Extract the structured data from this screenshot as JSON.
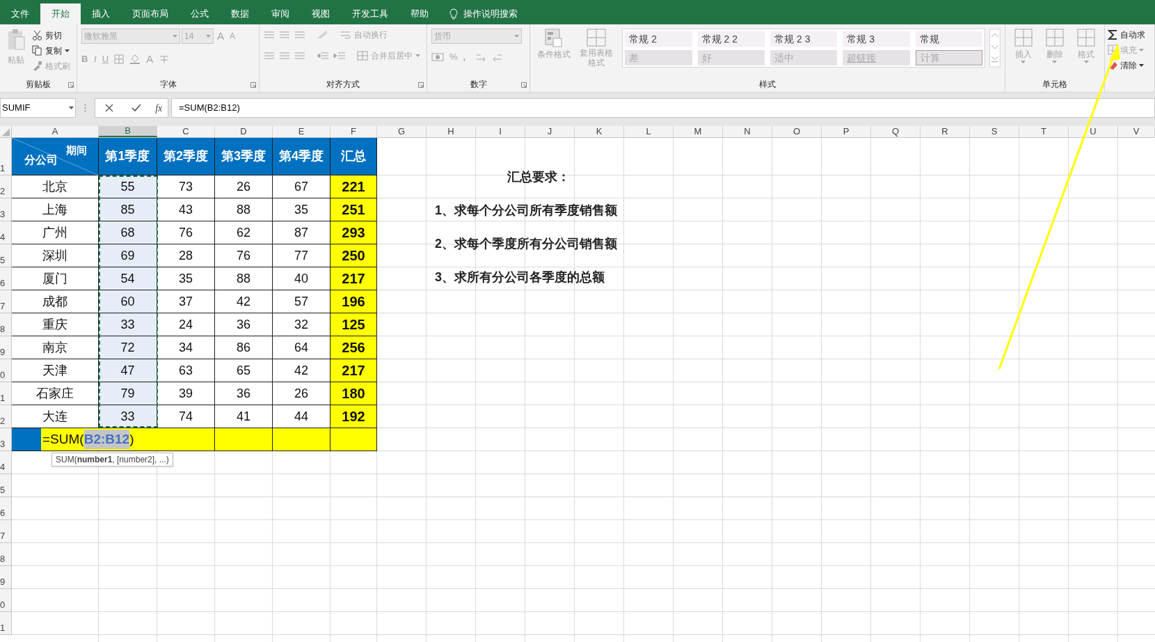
{
  "tabs": [
    {
      "label": "文件",
      "selected": false
    },
    {
      "label": "开始",
      "selected": true
    },
    {
      "label": "插入",
      "selected": false
    },
    {
      "label": "页面布局",
      "selected": false
    },
    {
      "label": "公式",
      "selected": false
    },
    {
      "label": "数据",
      "selected": false
    },
    {
      "label": "审阅",
      "selected": false
    },
    {
      "label": "视图",
      "selected": false
    },
    {
      "label": "开发工具",
      "selected": false
    },
    {
      "label": "帮助",
      "selected": false
    }
  ],
  "search": {
    "label": "操作说明搜索"
  },
  "ribbon": [
    {
      "kind": "clipboard",
      "label": "剪贴板",
      "paste": {
        "label": "粘贴",
        "disabled": true
      },
      "items": [
        {
          "label": "剪切",
          "disabled": false
        },
        {
          "label": "复制",
          "disabled": false
        },
        {
          "label": "格式刷",
          "disabled": true
        }
      ]
    },
    {
      "kind": "font",
      "label": "字体",
      "font": "微软雅黑",
      "size": "14",
      "grow": "A",
      "shrink": "A",
      "styles": [
        "B",
        "I",
        "U"
      ],
      "color_glyph": "A"
    },
    {
      "kind": "alignment",
      "label": "对齐方式",
      "items": [
        {
          "label": "自动换行",
          "disabled": true
        },
        {
          "label": "合并后居中",
          "disabled": true
        }
      ]
    },
    {
      "kind": "number",
      "label": "数字",
      "format": "货币",
      "percent": "%",
      "comma": ","
    },
    {
      "kind": "styles",
      "label": "样式",
      "items": [
        {
          "label": "条件格式",
          "disabled": true
        },
        {
          "label": "套用表格格式",
          "disabled": true
        }
      ],
      "gallery": [
        {
          "label": "常规 2"
        },
        {
          "label": "常规 2 2"
        },
        {
          "label": "常规 2 3"
        },
        {
          "label": "常规 3"
        },
        {
          "label": "常规"
        },
        {
          "label": "差"
        },
        {
          "label": "好"
        },
        {
          "label": "适中"
        },
        {
          "label": "超链接"
        },
        {
          "label": "计算"
        }
      ]
    },
    {
      "kind": "cells",
      "label": "单元格",
      "items": [
        {
          "label": "插入",
          "disabled": true
        },
        {
          "label": "删除",
          "disabled": true
        },
        {
          "label": "格式",
          "disabled": true
        }
      ]
    },
    {
      "kind": "editing",
      "items": [
        {
          "label": "自动求",
          "disabled": false
        },
        {
          "label": "填充",
          "disabled": true
        },
        {
          "label": "清除",
          "disabled": false
        }
      ]
    }
  ],
  "formula_bar": {
    "name_box": "SUMIF",
    "fx": "fx",
    "formula": "=SUM(B2:B12)"
  },
  "sheet": {
    "columns": [
      {
        "label": "A",
        "selected": false
      },
      {
        "label": "B",
        "selected": true
      },
      {
        "label": "C",
        "selected": false
      },
      {
        "label": "D",
        "selected": false
      },
      {
        "label": "E",
        "selected": false
      },
      {
        "label": "F",
        "selected": false
      },
      {
        "label": "G",
        "selected": false
      },
      {
        "label": "H",
        "selected": false
      },
      {
        "label": "I",
        "selected": false
      },
      {
        "label": "J",
        "selected": false
      },
      {
        "label": "K",
        "selected": false
      },
      {
        "label": "L",
        "selected": false
      },
      {
        "label": "M",
        "selected": false
      },
      {
        "label": "N",
        "selected": false
      },
      {
        "label": "O",
        "selected": false
      },
      {
        "label": "P",
        "selected": false
      },
      {
        "label": "Q",
        "selected": false
      },
      {
        "label": "R",
        "selected": false
      },
      {
        "label": "S",
        "selected": false
      },
      {
        "label": "T",
        "selected": false
      },
      {
        "label": "U",
        "selected": false
      },
      {
        "label": "V",
        "selected": false
      }
    ],
    "row_numbers": [
      "1",
      "2",
      "3",
      "4",
      "5",
      "6",
      "7",
      "8",
      "9",
      "0",
      "1",
      "2",
      "3",
      "4",
      "5",
      "6",
      "7",
      "8",
      "9",
      "0",
      "1"
    ],
    "table": {
      "corner": {
        "top": "期间",
        "bottom": "分公司"
      },
      "headers": [
        "第1季度",
        "第2季度",
        "第3季度",
        "第4季度",
        "汇总"
      ],
      "rows": [
        {
          "city": "北京",
          "values": [
            "55",
            "73",
            "26",
            "67"
          ],
          "total": "221"
        },
        {
          "city": "上海",
          "values": [
            "85",
            "43",
            "88",
            "35"
          ],
          "total": "251"
        },
        {
          "city": "广州",
          "values": [
            "68",
            "76",
            "62",
            "87"
          ],
          "total": "293"
        },
        {
          "city": "深圳",
          "values": [
            "69",
            "28",
            "76",
            "77"
          ],
          "total": "250"
        },
        {
          "city": "厦门",
          "values": [
            "54",
            "35",
            "88",
            "40"
          ],
          "total": "217"
        },
        {
          "city": "成都",
          "values": [
            "60",
            "37",
            "42",
            "57"
          ],
          "total": "196"
        },
        {
          "city": "重庆",
          "values": [
            "33",
            "24",
            "36",
            "32"
          ],
          "total": "125"
        },
        {
          "city": "南京",
          "values": [
            "72",
            "34",
            "86",
            "64"
          ],
          "total": "256"
        },
        {
          "city": "天津",
          "values": [
            "47",
            "63",
            "65",
            "42"
          ],
          "total": "217"
        },
        {
          "city": "石家庄",
          "values": [
            "79",
            "39",
            "36",
            "26"
          ],
          "total": "180"
        },
        {
          "city": "大连",
          "values": [
            "33",
            "74",
            "41",
            "44"
          ],
          "total": "192"
        }
      ]
    },
    "editor": {
      "prefix": "=SUM(",
      "ref": "B2:B12",
      "suffix": ")"
    },
    "tooltip": "SUM(**number1**, [number2], ...)",
    "notes": {
      "title": "汇总要求：",
      "items": [
        "1、求每个分公司所有季度销售额",
        "2、求每个季度所有分公司销售额",
        "3、求所有分公司各季度的总额"
      ]
    }
  }
}
